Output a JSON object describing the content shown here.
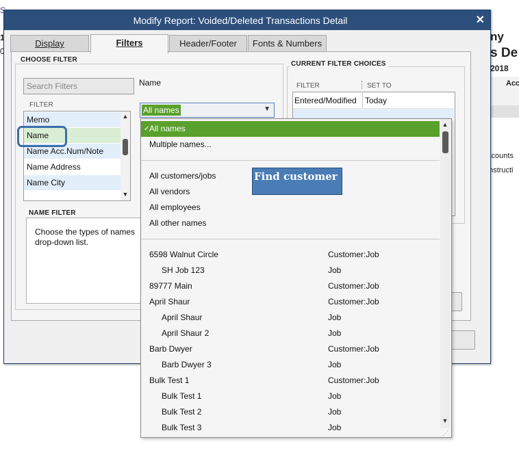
{
  "background_report": {
    "left_fragments": [
      "S",
      "1",
      "0"
    ],
    "right_fragments": {
      "title_part1": "ny",
      "title_part2": "s De",
      "year": "2018",
      "col_header": "Acc",
      "line1": "ccounts",
      "line2": "nstructi"
    }
  },
  "dialog": {
    "title": "Modify Report: Voided/Deleted Transactions Detail",
    "close_glyph": "✕",
    "tabs": [
      {
        "label": "Display"
      },
      {
        "label": "Filters"
      },
      {
        "label": "Header/Footer"
      },
      {
        "label": "Fonts & Numbers"
      }
    ]
  },
  "choose_filter": {
    "heading": "CHOOSE FILTER",
    "search_placeholder": "Search Filters",
    "list_header": "FILTER",
    "items": [
      "Memo",
      "Name",
      "Name Acc.Num/Note",
      "Name Address",
      "Name City"
    ],
    "selected_item": "Name"
  },
  "name_selector": {
    "label": "Name",
    "value": "All names"
  },
  "current_filters": {
    "heading": "CURRENT FILTER CHOICES",
    "col_filter": "FILTER",
    "col_set_to": "SET TO",
    "rows": [
      {
        "filter": "Entered/Modified",
        "set_to": "Today"
      }
    ]
  },
  "name_filter": {
    "heading": "NAME FILTER",
    "description_line1": "Choose the types of names",
    "description_line2": "drop-down list."
  },
  "dropdown": {
    "top_options": [
      "All names",
      "Multiple names..."
    ],
    "selected_check": "✓",
    "type_options": [
      "All customers/jobs",
      "All vendors",
      "All employees",
      "All other names"
    ],
    "names": [
      {
        "name": "6598 Walnut Circle",
        "type": "Customer:Job",
        "indent": false
      },
      {
        "name": "SH Job 123",
        "type": "Job",
        "indent": true
      },
      {
        "name": "89777 Main",
        "type": "Customer:Job",
        "indent": false
      },
      {
        "name": "April Shaur",
        "type": "Customer:Job",
        "indent": false
      },
      {
        "name": "April Shaur",
        "type": "Job",
        "indent": true
      },
      {
        "name": "April Shaur 2",
        "type": "Job",
        "indent": true
      },
      {
        "name": "Barb Dwyer",
        "type": "Customer:Job",
        "indent": false
      },
      {
        "name": "Barb Dwyer 3",
        "type": "Job",
        "indent": true
      },
      {
        "name": "Bulk Test 1",
        "type": "Customer:Job",
        "indent": false
      },
      {
        "name": "Bulk Test 1",
        "type": "Job",
        "indent": true
      },
      {
        "name": "Bulk Test 2",
        "type": "Job",
        "indent": true
      },
      {
        "name": "Bulk Test 3",
        "type": "Job",
        "indent": true
      }
    ]
  },
  "callout": {
    "text": "Find customer"
  },
  "colors": {
    "titlebar": "#2c4f7c",
    "selection_green": "#5aa02c",
    "callout_blue": "#4a7cb5",
    "ring_blue": "#3b6fa8"
  }
}
